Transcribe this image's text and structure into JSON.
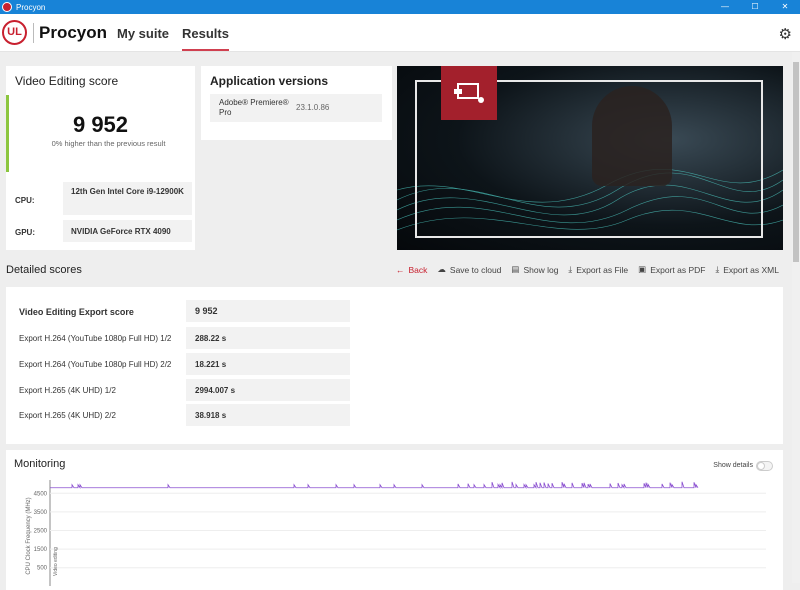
{
  "window": {
    "title": "Procyon"
  },
  "header": {
    "logo": "UL",
    "brand": "Procyon",
    "tabs": [
      {
        "label": "My suite"
      },
      {
        "label": "Results"
      }
    ]
  },
  "score_card": {
    "title": "Video Editing score",
    "score": "9 952",
    "comparison": "0% higher than the previous result",
    "cpu_label": "CPU:",
    "cpu_value": "12th Gen Intel Core i9-12900K",
    "gpu_label": "GPU:",
    "gpu_value": "NVIDIA GeForce RTX 4090"
  },
  "app_versions": {
    "title": "Application versions",
    "apps": [
      {
        "name": "Adobe® Premiere® Pro",
        "version": "23.1.0.86"
      }
    ]
  },
  "detailed": {
    "title": "Detailed scores",
    "actions": {
      "back": "Back",
      "save": "Save to cloud",
      "log": "Show log",
      "file": "Export as File",
      "pdf": "Export as PDF",
      "xml": "Export as XML"
    },
    "rows": [
      {
        "label": "Video Editing Export score",
        "value": "9 952"
      },
      {
        "label": "Export H.264 (YouTube 1080p Full HD) 1/2",
        "value": "288.22 s"
      },
      {
        "label": "Export H.264 (YouTube 1080p Full HD) 2/2",
        "value": "18.221 s"
      },
      {
        "label": "Export H.265 (4K UHD) 1/2",
        "value": "2994.007 s"
      },
      {
        "label": "Export H.265 (4K UHD) 2/2",
        "value": "38.918 s"
      }
    ]
  },
  "monitoring": {
    "title": "Monitoring",
    "show_details": "Show details",
    "show_details_on": false
  },
  "chart_data": {
    "type": "line",
    "ylabel": "CPU Clock Frequency (MHz)",
    "annotation": "Video editing",
    "yticks": [
      4500,
      3500,
      2500,
      1500,
      500
    ],
    "ylim": [
      0,
      5200
    ],
    "series": [
      {
        "name": "CPU Clock Frequency",
        "color": "#8a4fd0",
        "typical": 4800
      }
    ]
  },
  "colors": {
    "accent": "#c8202f",
    "titlebar": "#1883d7",
    "score_bar": "#8cc63f"
  }
}
